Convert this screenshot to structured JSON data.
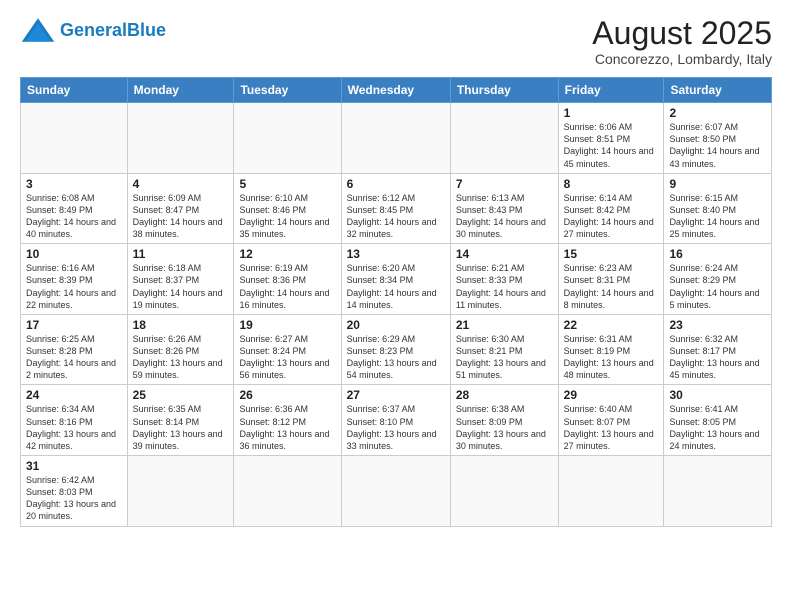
{
  "logo": {
    "text_general": "General",
    "text_blue": "Blue"
  },
  "header": {
    "title": "August 2025",
    "subtitle": "Concorezzo, Lombardy, Italy"
  },
  "weekdays": [
    "Sunday",
    "Monday",
    "Tuesday",
    "Wednesday",
    "Thursday",
    "Friday",
    "Saturday"
  ],
  "weeks": [
    [
      {
        "day": "",
        "info": ""
      },
      {
        "day": "",
        "info": ""
      },
      {
        "day": "",
        "info": ""
      },
      {
        "day": "",
        "info": ""
      },
      {
        "day": "",
        "info": ""
      },
      {
        "day": "1",
        "info": "Sunrise: 6:06 AM\nSunset: 8:51 PM\nDaylight: 14 hours and 45 minutes."
      },
      {
        "day": "2",
        "info": "Sunrise: 6:07 AM\nSunset: 8:50 PM\nDaylight: 14 hours and 43 minutes."
      }
    ],
    [
      {
        "day": "3",
        "info": "Sunrise: 6:08 AM\nSunset: 8:49 PM\nDaylight: 14 hours and 40 minutes."
      },
      {
        "day": "4",
        "info": "Sunrise: 6:09 AM\nSunset: 8:47 PM\nDaylight: 14 hours and 38 minutes."
      },
      {
        "day": "5",
        "info": "Sunrise: 6:10 AM\nSunset: 8:46 PM\nDaylight: 14 hours and 35 minutes."
      },
      {
        "day": "6",
        "info": "Sunrise: 6:12 AM\nSunset: 8:45 PM\nDaylight: 14 hours and 32 minutes."
      },
      {
        "day": "7",
        "info": "Sunrise: 6:13 AM\nSunset: 8:43 PM\nDaylight: 14 hours and 30 minutes."
      },
      {
        "day": "8",
        "info": "Sunrise: 6:14 AM\nSunset: 8:42 PM\nDaylight: 14 hours and 27 minutes."
      },
      {
        "day": "9",
        "info": "Sunrise: 6:15 AM\nSunset: 8:40 PM\nDaylight: 14 hours and 25 minutes."
      }
    ],
    [
      {
        "day": "10",
        "info": "Sunrise: 6:16 AM\nSunset: 8:39 PM\nDaylight: 14 hours and 22 minutes."
      },
      {
        "day": "11",
        "info": "Sunrise: 6:18 AM\nSunset: 8:37 PM\nDaylight: 14 hours and 19 minutes."
      },
      {
        "day": "12",
        "info": "Sunrise: 6:19 AM\nSunset: 8:36 PM\nDaylight: 14 hours and 16 minutes."
      },
      {
        "day": "13",
        "info": "Sunrise: 6:20 AM\nSunset: 8:34 PM\nDaylight: 14 hours and 14 minutes."
      },
      {
        "day": "14",
        "info": "Sunrise: 6:21 AM\nSunset: 8:33 PM\nDaylight: 14 hours and 11 minutes."
      },
      {
        "day": "15",
        "info": "Sunrise: 6:23 AM\nSunset: 8:31 PM\nDaylight: 14 hours and 8 minutes."
      },
      {
        "day": "16",
        "info": "Sunrise: 6:24 AM\nSunset: 8:29 PM\nDaylight: 14 hours and 5 minutes."
      }
    ],
    [
      {
        "day": "17",
        "info": "Sunrise: 6:25 AM\nSunset: 8:28 PM\nDaylight: 14 hours and 2 minutes."
      },
      {
        "day": "18",
        "info": "Sunrise: 6:26 AM\nSunset: 8:26 PM\nDaylight: 13 hours and 59 minutes."
      },
      {
        "day": "19",
        "info": "Sunrise: 6:27 AM\nSunset: 8:24 PM\nDaylight: 13 hours and 56 minutes."
      },
      {
        "day": "20",
        "info": "Sunrise: 6:29 AM\nSunset: 8:23 PM\nDaylight: 13 hours and 54 minutes."
      },
      {
        "day": "21",
        "info": "Sunrise: 6:30 AM\nSunset: 8:21 PM\nDaylight: 13 hours and 51 minutes."
      },
      {
        "day": "22",
        "info": "Sunrise: 6:31 AM\nSunset: 8:19 PM\nDaylight: 13 hours and 48 minutes."
      },
      {
        "day": "23",
        "info": "Sunrise: 6:32 AM\nSunset: 8:17 PM\nDaylight: 13 hours and 45 minutes."
      }
    ],
    [
      {
        "day": "24",
        "info": "Sunrise: 6:34 AM\nSunset: 8:16 PM\nDaylight: 13 hours and 42 minutes."
      },
      {
        "day": "25",
        "info": "Sunrise: 6:35 AM\nSunset: 8:14 PM\nDaylight: 13 hours and 39 minutes."
      },
      {
        "day": "26",
        "info": "Sunrise: 6:36 AM\nSunset: 8:12 PM\nDaylight: 13 hours and 36 minutes."
      },
      {
        "day": "27",
        "info": "Sunrise: 6:37 AM\nSunset: 8:10 PM\nDaylight: 13 hours and 33 minutes."
      },
      {
        "day": "28",
        "info": "Sunrise: 6:38 AM\nSunset: 8:09 PM\nDaylight: 13 hours and 30 minutes."
      },
      {
        "day": "29",
        "info": "Sunrise: 6:40 AM\nSunset: 8:07 PM\nDaylight: 13 hours and 27 minutes."
      },
      {
        "day": "30",
        "info": "Sunrise: 6:41 AM\nSunset: 8:05 PM\nDaylight: 13 hours and 24 minutes."
      }
    ],
    [
      {
        "day": "31",
        "info": "Sunrise: 6:42 AM\nSunset: 8:03 PM\nDaylight: 13 hours and 20 minutes."
      },
      {
        "day": "",
        "info": ""
      },
      {
        "day": "",
        "info": ""
      },
      {
        "day": "",
        "info": ""
      },
      {
        "day": "",
        "info": ""
      },
      {
        "day": "",
        "info": ""
      },
      {
        "day": "",
        "info": ""
      }
    ]
  ]
}
